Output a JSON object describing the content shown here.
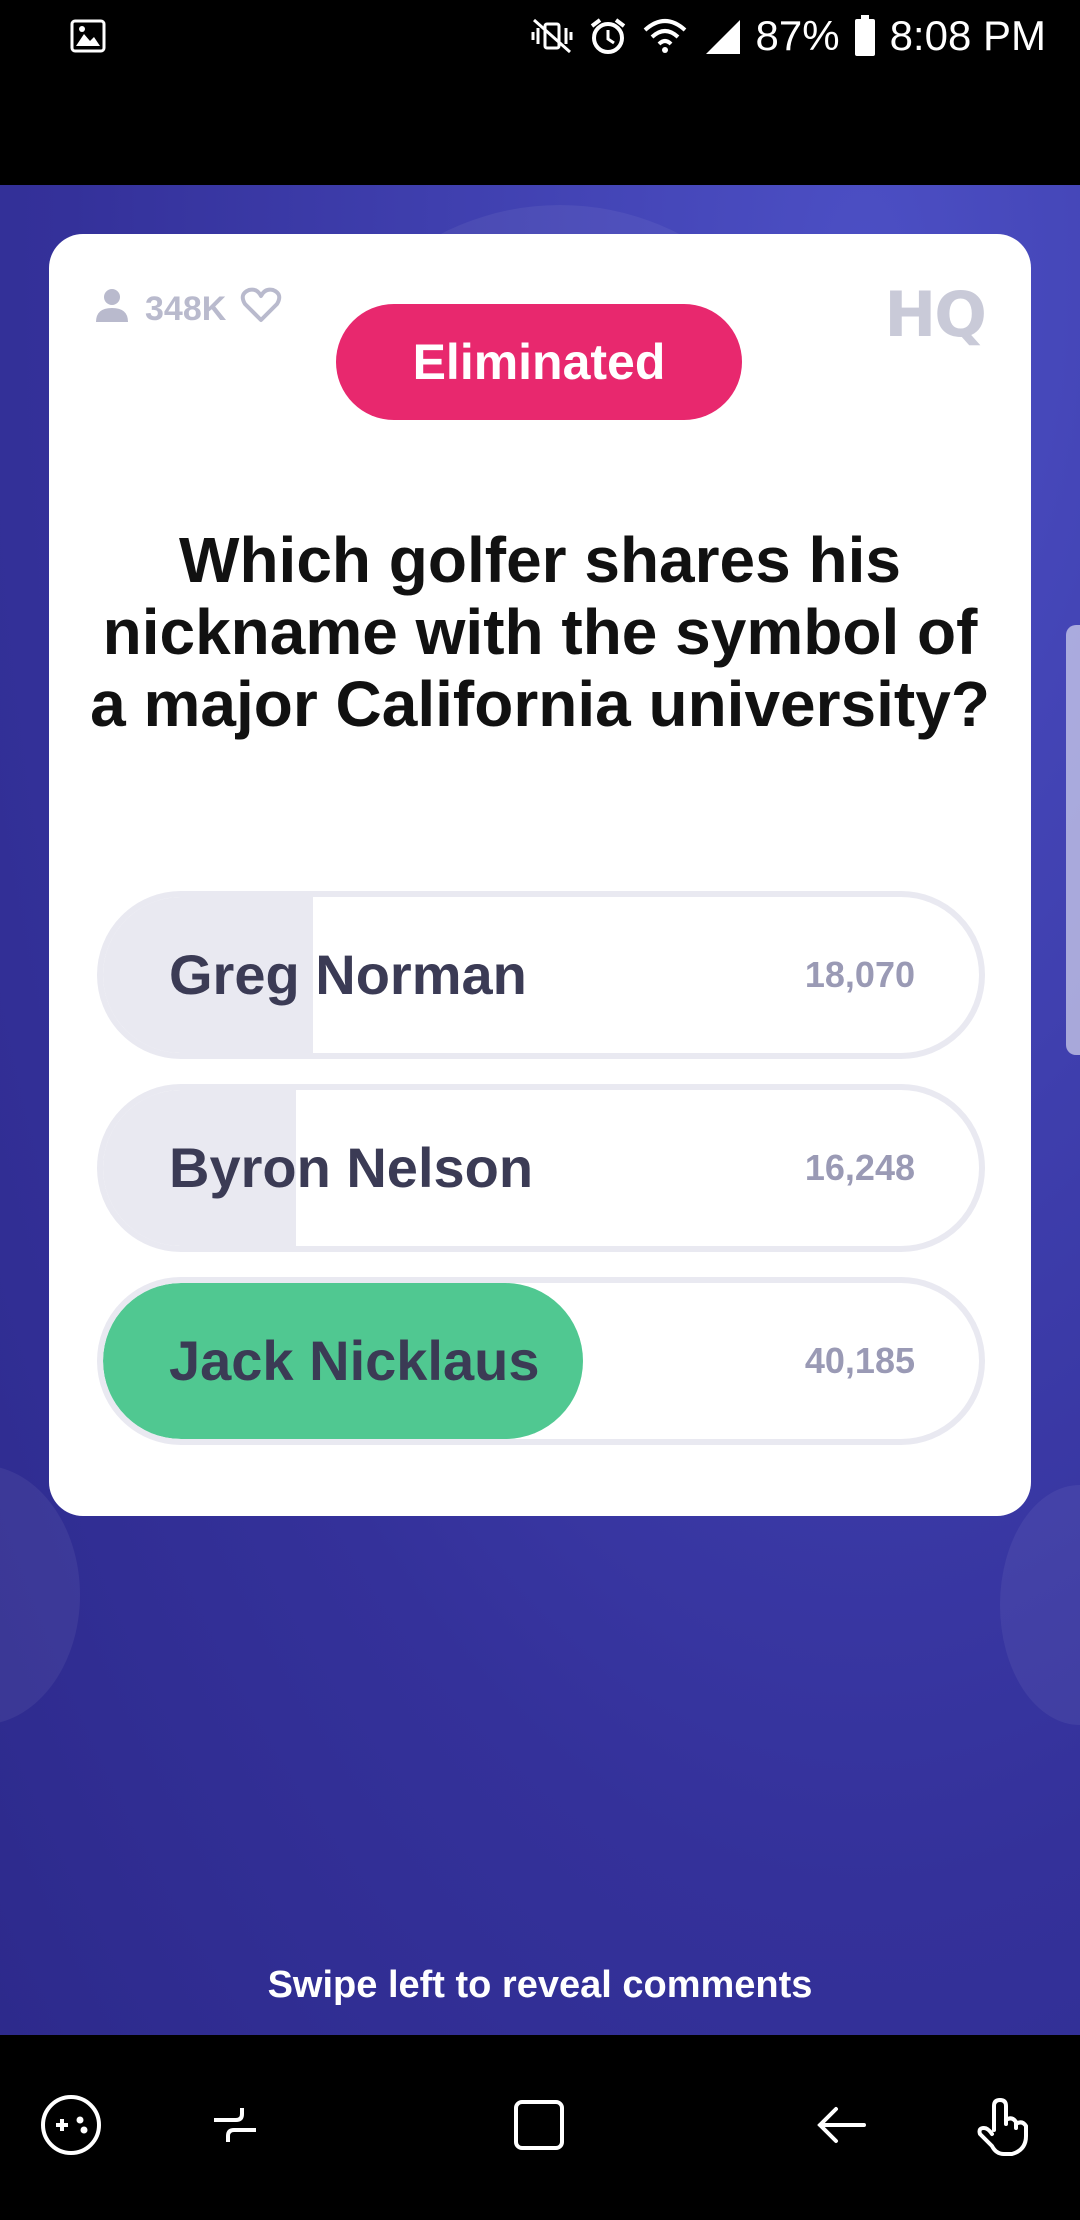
{
  "status_bar": {
    "battery": "87%",
    "time": "8:08 PM"
  },
  "card": {
    "viewer_count": "348K",
    "logo": "HQ",
    "status_label": "Eliminated",
    "question": "Which golfer shares his nickname with the symbol of a major California university?",
    "answers": [
      {
        "label": "Greg Norman",
        "count": "18,070",
        "fraction": 0.24,
        "correct": false
      },
      {
        "label": "Byron Nelson",
        "count": "16,248",
        "fraction": 0.22,
        "correct": false
      },
      {
        "label": "Jack Nicklaus",
        "count": "40,185",
        "fraction": 0.54,
        "correct": true
      }
    ]
  },
  "swipe_hint": "Swipe left to reveal comments",
  "colors": {
    "eliminated": "#e8286e",
    "correct": "#50c891",
    "background": "#3a38a6"
  },
  "icons": {
    "status_left": "image-icon",
    "status_right": [
      "mute-vibrate-icon",
      "alarm-icon",
      "wifi-icon",
      "signal-icon",
      "battery-icon"
    ],
    "nav": [
      "game-tools-icon",
      "recent-apps-icon",
      "home-icon",
      "back-icon",
      "touch-icon"
    ]
  }
}
